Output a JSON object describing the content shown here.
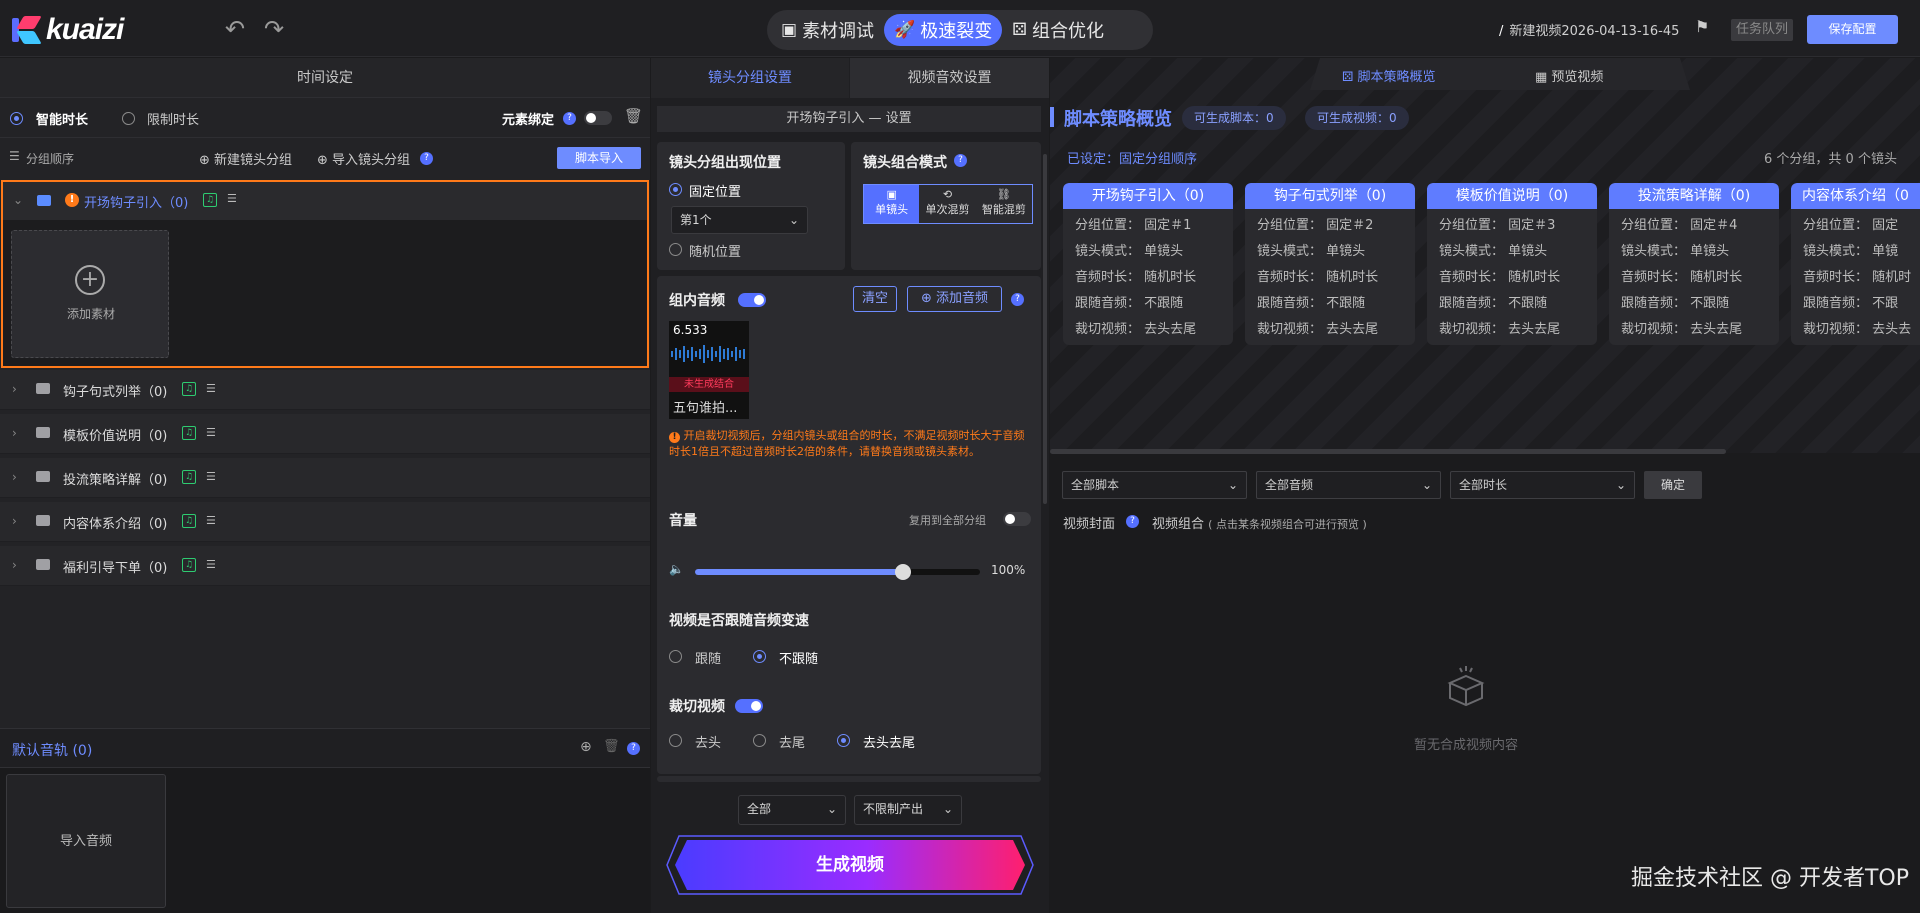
{
  "app": {
    "brand": "kuaizi",
    "draft_name": "新建视频2026-04-13-16-45",
    "queue_label": "任务队列",
    "save_label": "保存配置"
  },
  "modes": [
    {
      "label": "素材调试"
    },
    {
      "label": "极速裂变"
    },
    {
      "label": "组合优化"
    }
  ],
  "left": {
    "title": "时间设定",
    "smart_duration": "智能时长",
    "limit_duration": "限制时长",
    "element_bind": "元素绑定",
    "group_order": "分组顺序",
    "new_group": "新建镜头分组",
    "import_group": "导入镜头分组",
    "script_import": "脚本导入",
    "add_material": "添加素材",
    "groups": [
      {
        "name": "开场钩子引入（0)"
      },
      {
        "name": "钩子句式列举（0)"
      },
      {
        "name": "模板价值说明（0)"
      },
      {
        "name": "投流策略详解（0)"
      },
      {
        "name": "内容体系介绍（0)"
      },
      {
        "name": "福利引导下单（0)"
      }
    ],
    "default_track": "默认音轨",
    "default_track_count": "(0)",
    "import_audio": "导入音频"
  },
  "mid": {
    "tab_group": "镜头分组设置",
    "tab_sound": "视频音效设置",
    "subtitle": "开场钩子引入 — 设置",
    "position_title": "镜头分组出现位置",
    "fixed_position": "固定位置",
    "position_select": "第1个",
    "random_position": "随机位置",
    "combine_title": "镜头组合模式",
    "combine_modes": [
      "单镜头",
      "单次混剪",
      "智能混剪"
    ],
    "group_audio": "组内音频",
    "clear": "清空",
    "add_audio": "添加音频",
    "audio_time": "6.533",
    "audio_status": "未生成结合",
    "audio_name": "五句谁拍...",
    "warning": "开启裁切视频后，分组内镜头或组合的时长，不满足视频时长大于音频时长1倍且不超过音频时长2倍的条件，请替换音频或镜头素材。",
    "volume": "音量",
    "apply_all": "复用到全部分组",
    "volume_value": "100%",
    "volume_level": 0.73,
    "follow_title": "视频是否跟随音频变速",
    "follow": "跟随",
    "not_follow": "不跟随",
    "crop_title": "裁切视频",
    "crop_head": "去头",
    "crop_tail": "去尾",
    "crop_both": "去头去尾",
    "output_all": "全部",
    "output_limit": "不限制产出",
    "generate": "生成视频"
  },
  "right": {
    "tab_overview": "脚本策略概览",
    "tab_preview": "预览视频",
    "title": "脚本策略概览",
    "scripts_badge": "可生成脚本：0",
    "videos_badge": "可生成视频：0",
    "set_label": "已设定：固定分组顺序",
    "group_count": "6 个分组，共 0 个镜头",
    "cards": [
      {
        "title": "开场钩子引入（0)",
        "position": "分组位置：  固定＃1",
        "mode": "镜头模式：  单镜头",
        "duration": "音频时长：  随机时长",
        "follow": "跟随音频：  不跟随",
        "crop": "裁切视频：  去头去尾"
      },
      {
        "title": "钩子句式列举（0)",
        "position": "分组位置：  固定＃2",
        "mode": "镜头模式：  单镜头",
        "duration": "音频时长：  随机时长",
        "follow": "跟随音频：  不跟随",
        "crop": "裁切视频：  去头去尾"
      },
      {
        "title": "模板价值说明（0)",
        "position": "分组位置：  固定＃3",
        "mode": "镜头模式：  单镜头",
        "duration": "音频时长：  随机时长",
        "follow": "跟随音频：  不跟随",
        "crop": "裁切视频：  去头去尾"
      },
      {
        "title": "投流策略详解（0)",
        "position": "分组位置：  固定＃4",
        "mode": "镜头模式：  单镜头",
        "duration": "音频时长：  随机时长",
        "follow": "跟随音频：  不跟随",
        "crop": "裁切视频：  去头去尾"
      },
      {
        "title": "内容体系介绍（0",
        "position": "分组位置：  固定",
        "mode": "镜头模式：  单镜",
        "duration": "音频时长：  随机时",
        "follow": "跟随音频：  不跟",
        "crop": "裁切视频：  去头去"
      }
    ],
    "filter_script": "全部脚本",
    "filter_audio": "全部音频",
    "filter_duration": "全部时长",
    "confirm": "确定",
    "cover_label": "视频封面",
    "combo_label": "视频组合",
    "combo_hint": "( 点击某条视频组合可进行预览 )",
    "empty": "暂无合成视频内容",
    "watermark": "掘金技术社区 @ 开发者TOP"
  }
}
